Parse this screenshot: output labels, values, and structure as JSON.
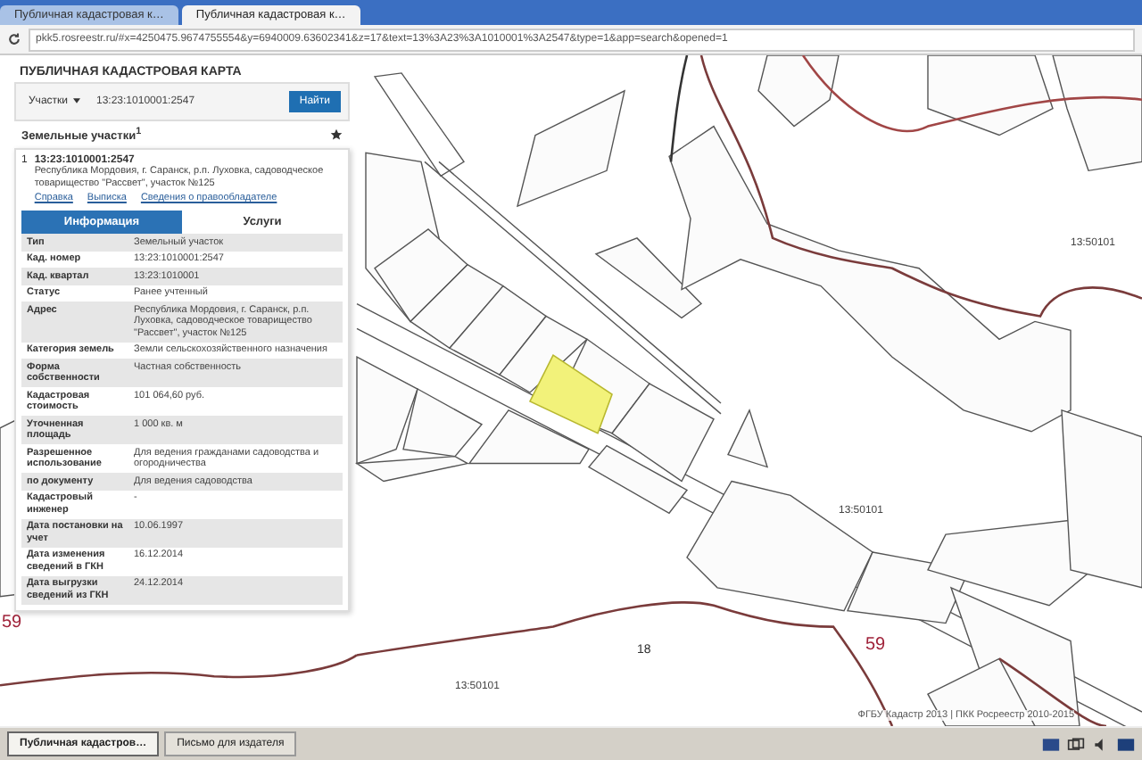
{
  "browser": {
    "tabs": [
      {
        "label": "Публичная кадастровая к…",
        "selected": false
      },
      {
        "label": "Публичная кадастровая к…",
        "selected": true
      }
    ],
    "url": "pkk5.rosreestr.ru/#x=4250475.9674755554&y=6940009.63602341&z=17&text=13%3A23%3A1010001%3A2547&type=1&app=search&opened=1"
  },
  "panel": {
    "title": "ПУБЛИЧНАЯ КАДАСТРОВАЯ КАРТА",
    "search": {
      "type": "Участки",
      "value": "13:23:1010001:2547",
      "button": "Найти"
    },
    "results": {
      "heading": "Земельные участки",
      "count": "1"
    },
    "parcel": {
      "index": "1",
      "number": "13:23:1010001:2547",
      "address": "Республика Мордовия, г. Саранск, р.п. Луховка, садоводческое товарищество \"Рассвет\", участок №125",
      "links": [
        "Справка",
        "Выписка",
        "Сведения о правообладателе"
      ]
    },
    "tabs": [
      {
        "label": "Информация",
        "selected": true
      },
      {
        "label": "Услуги",
        "selected": false
      }
    ],
    "rows": [
      {
        "label": "Тип",
        "value": "Земельный участок"
      },
      {
        "label": "Кад. номер",
        "value": "13:23:1010001:2547"
      },
      {
        "label": "Кад. квартал",
        "value": "13:23:1010001"
      },
      {
        "label": "Статус",
        "value": "Ранее учтенный"
      },
      {
        "label": "Адрес",
        "value": "Республика Мордовия, г. Саранск, р.п. Луховка, садоводческое товарищество \"Рассвет\", участок №125"
      },
      {
        "label": "Категория земель",
        "value": "Земли сельскохозяйственного назначения"
      },
      {
        "label": "Форма собственности",
        "value": "Частная собственность"
      },
      {
        "label": "Кадастровая стоимость",
        "value": "101 064,60 руб."
      },
      {
        "label": "Уточненная площадь",
        "value": "1 000 кв. м"
      },
      {
        "label": "Разрешенное использование",
        "value": "Для ведения гражданами садоводства и огородничества"
      },
      {
        "label": "по документу",
        "value": "Для ведения садоводства"
      },
      {
        "label": "Кадастровый инженер",
        "value": "-"
      },
      {
        "label": "Дата постановки на учет",
        "value": "10.06.1997"
      },
      {
        "label": "Дата изменения сведений в ГКН",
        "value": "16.12.2014"
      },
      {
        "label": "Дата выгрузки сведений из ГКН",
        "value": "24.12.2014"
      }
    ]
  },
  "map": {
    "labels": [
      {
        "text": "13:50101",
        "kind": "quarter"
      },
      {
        "text": "13:50101",
        "kind": "quarter"
      },
      {
        "text": "13:50101",
        "kind": "quarter"
      },
      {
        "text": "18",
        "kind": "district"
      },
      {
        "text": "59",
        "kind": "boundary"
      },
      {
        "text": "59",
        "kind": "boundary"
      }
    ],
    "attribution": "ФГБУ Кадастр 2013 | ПКК Росреестр 2010-2015"
  },
  "taskbar": {
    "items": [
      {
        "label": "Публичная кадастров…",
        "selected": true
      },
      {
        "label": "Письмо для издателя",
        "selected": false
      }
    ]
  }
}
